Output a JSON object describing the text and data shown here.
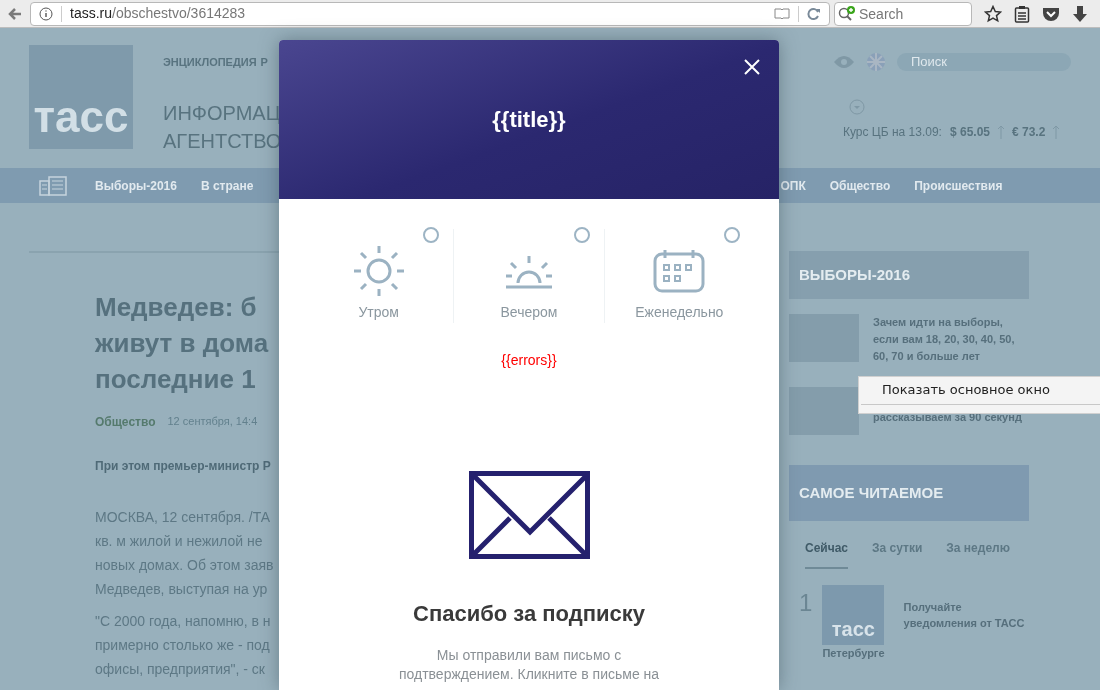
{
  "browser": {
    "url_host": "tass.ru",
    "url_path": "/obschestvo/3614283",
    "search_placeholder": "Search"
  },
  "site": {
    "top_link": "ЭНЦИКЛОПЕДИЯ",
    "top_link_cut": "Р",
    "logo": "тасс",
    "agency_line_1": "ИНФОРМАЦ",
    "agency_line_2": "АГЕНТСТВО",
    "search_placeholder": "Поиск",
    "rates_label": "Курс ЦБ на 13.09:",
    "rates": [
      {
        "value": "$ 65.05"
      },
      {
        "value": "€ 73.2"
      }
    ],
    "nav_left": [
      "Выборы-2016",
      "В стране"
    ],
    "nav_right": [
      "ОПК",
      "Общество",
      "Происшествия"
    ]
  },
  "article": {
    "headline": [
      "Медведев: б",
      "живут в дома",
      "последние 1"
    ],
    "section": "Общество",
    "date": "12 сентября, 14:4",
    "lead": "При этом премьер-министр Р",
    "paragraphs": [
      [
        "МОСКВА, 12 сентября. /ТА",
        "кв. м жилой и нежилой не",
        "новых домах. Об этом заяв",
        "Медведев, выступая на ур"
      ],
      [
        "\"С 2000 года, напомню, в н",
        "примерно столько же - под",
        "офисы, предприятия\", - ск"
      ]
    ]
  },
  "sidebar": {
    "elections_title": "ВЫБОРЫ-2016",
    "elections_news": [
      {
        "text": "Зачем идти на выборы, если вам 18, 20, 30, 40, 50, 60, 70 и больше лет"
      },
      {
        "text": "рассказываем за 90 секунд"
      }
    ],
    "popular_title": "САМОЕ ЧИТАЕМОЕ",
    "popular_tabs": [
      {
        "label": "Сейчас",
        "selected": true
      },
      {
        "label": "За сутки",
        "selected": false
      },
      {
        "label": "За неделю",
        "selected": false
      }
    ],
    "popular_item": {
      "rank": "1",
      "logo": "тасс",
      "caption": "Петербурге"
    },
    "notification": "Получайте уведомления от ТАСС"
  },
  "modal": {
    "title": "{{title}}",
    "options": [
      {
        "kind": "sun",
        "label": "Утром",
        "selected": false
      },
      {
        "kind": "sunset",
        "label": "Вечером",
        "selected": false
      },
      {
        "kind": "calendar",
        "label": "Еженедельно",
        "selected": false
      }
    ],
    "errors": "{{errors}}",
    "thanks_title": "Спасибо за подписку",
    "thanks_text": "Мы отправили вам письмо с подтверждением. Кликните в письме на"
  },
  "context_menu": {
    "items": [
      "Показать основное окно"
    ]
  }
}
